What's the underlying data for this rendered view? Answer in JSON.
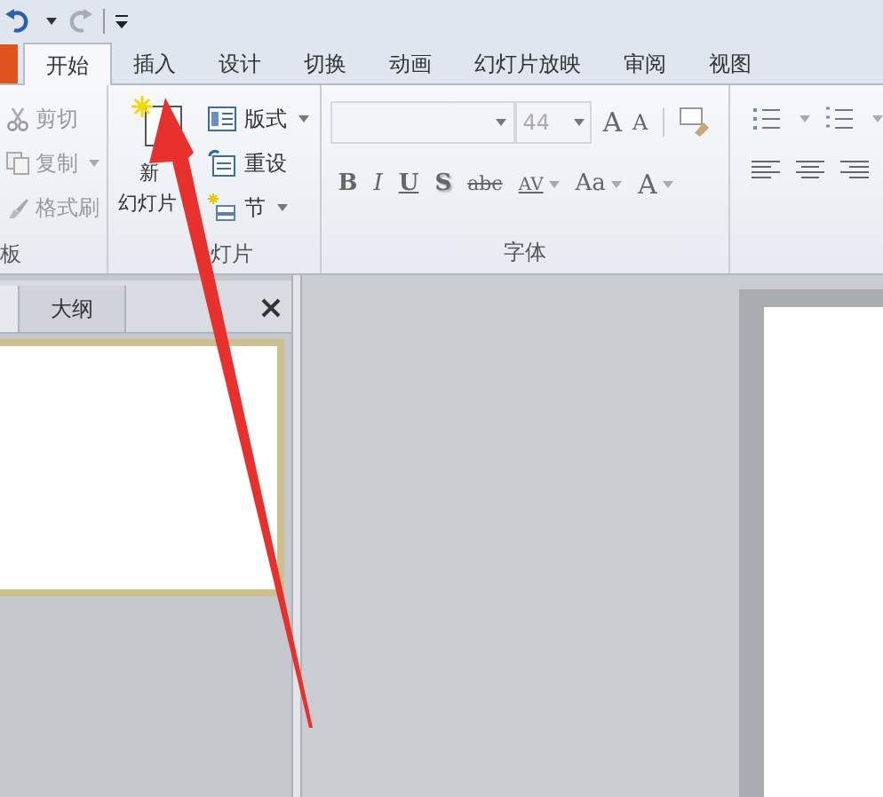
{
  "tabs": [
    {
      "label": "开始",
      "selected": true
    },
    {
      "label": "插入",
      "selected": false
    },
    {
      "label": "设计",
      "selected": false
    },
    {
      "label": "切换",
      "selected": false
    },
    {
      "label": "动画",
      "selected": false
    },
    {
      "label": "幻灯片放映",
      "selected": false
    },
    {
      "label": "审阅",
      "selected": false
    },
    {
      "label": "视图",
      "selected": false
    }
  ],
  "clipboard": {
    "label": "板",
    "items": [
      {
        "kind": "cut",
        "label": "剪切",
        "disabled": true,
        "menu": false
      },
      {
        "kind": "copy",
        "label": "复制",
        "disabled": true,
        "menu": true
      },
      {
        "kind": "painter",
        "label": "格式刷",
        "disabled": true,
        "menu": false
      }
    ]
  },
  "slides": {
    "label": "灯片",
    "new_slide": {
      "line1": "新",
      "line2": "幻灯片"
    },
    "items": [
      {
        "kind": "layout",
        "label": "版式",
        "menu": true
      },
      {
        "kind": "reset",
        "label": "重设",
        "menu": false
      },
      {
        "kind": "section",
        "label": "节",
        "menu": true
      }
    ]
  },
  "font": {
    "label": "字体",
    "font_size": "44",
    "size_buttons": [
      {
        "kind": "grow",
        "label": "A"
      },
      {
        "kind": "shrink",
        "label": "A"
      }
    ],
    "buttons": [
      {
        "kind": "bold",
        "label": "B",
        "menu": false
      },
      {
        "kind": "italic",
        "label": "I",
        "menu": false
      },
      {
        "kind": "underline",
        "label": "U",
        "menu": false
      },
      {
        "kind": "shadow",
        "label": "S",
        "menu": false
      },
      {
        "kind": "strike",
        "label": "abc",
        "menu": false
      },
      {
        "kind": "spacing",
        "label": "AV",
        "menu": true
      },
      {
        "kind": "case",
        "label": "Aa",
        "menu": true
      },
      {
        "kind": "color",
        "label": "A",
        "menu": true
      }
    ]
  },
  "pane_tabs": [
    {
      "label": "大纲",
      "selected": false
    }
  ]
}
